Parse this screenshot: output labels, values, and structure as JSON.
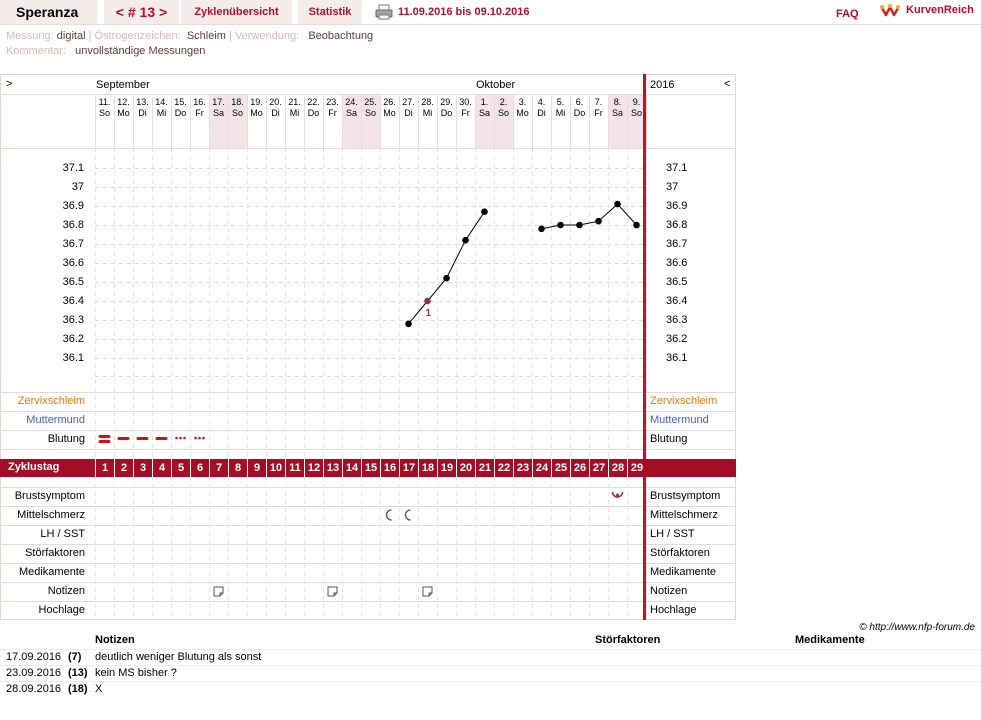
{
  "topbar": {
    "username": "Speranza",
    "cycle": "< # 13 >",
    "tab_overview": "Zyklenübersicht",
    "tab_stats": "Statistik",
    "date_range": "11.09.2016 bis 09.10.2016",
    "faq": "FAQ",
    "logo": "KurvenReich"
  },
  "meta": {
    "messung_label": "Messung:",
    "messung_value": "digital",
    "oestrogen_label": "Östrogenzeichen:",
    "oestrogen_value": "Schleim",
    "verwendung_label": "Verwendung:",
    "verwendung_value": "Beobachtung",
    "kommentar_label": "Kommentar:",
    "kommentar_value": "unvollständige Messungen"
  },
  "chart_header": {
    "left_arrow": ">",
    "right_arrow": "<",
    "month1": "September",
    "month2": "Oktober",
    "year": "2016"
  },
  "days": [
    {
      "d": "11.",
      "w": "So",
      "we": false
    },
    {
      "d": "12.",
      "w": "Mo",
      "we": false
    },
    {
      "d": "13.",
      "w": "Di",
      "we": false
    },
    {
      "d": "14.",
      "w": "Mi",
      "we": false
    },
    {
      "d": "15.",
      "w": "Do",
      "we": false
    },
    {
      "d": "16.",
      "w": "Fr",
      "we": false
    },
    {
      "d": "17.",
      "w": "Sa",
      "we": true
    },
    {
      "d": "18.",
      "w": "So",
      "we": true
    },
    {
      "d": "19.",
      "w": "Mo",
      "we": false
    },
    {
      "d": "20.",
      "w": "Di",
      "we": false
    },
    {
      "d": "21.",
      "w": "Mi",
      "we": false
    },
    {
      "d": "22.",
      "w": "Do",
      "we": false
    },
    {
      "d": "23.",
      "w": "Fr",
      "we": false
    },
    {
      "d": "24.",
      "w": "Sa",
      "we": true
    },
    {
      "d": "25.",
      "w": "So",
      "we": true
    },
    {
      "d": "26.",
      "w": "Mo",
      "we": false
    },
    {
      "d": "27.",
      "w": "Di",
      "we": false
    },
    {
      "d": "28.",
      "w": "Mi",
      "we": false
    },
    {
      "d": "29.",
      "w": "Do",
      "we": false
    },
    {
      "d": "30.",
      "w": "Fr",
      "we": false
    },
    {
      "d": "1.",
      "w": "Sa",
      "we": true
    },
    {
      "d": "2.",
      "w": "So",
      "we": true
    },
    {
      "d": "3.",
      "w": "Mo",
      "we": false
    },
    {
      "d": "4.",
      "w": "Di",
      "we": false
    },
    {
      "d": "5.",
      "w": "Mi",
      "we": false
    },
    {
      "d": "6.",
      "w": "Do",
      "we": false
    },
    {
      "d": "7.",
      "w": "Fr",
      "we": false
    },
    {
      "d": "8.",
      "w": "Sa",
      "we": true
    },
    {
      "d": "9.",
      "w": "So",
      "we": true
    }
  ],
  "chart_data": {
    "type": "line",
    "y_ticks": [
      "37.1",
      "37",
      "36.9",
      "36.8",
      "36.7",
      "36.6",
      "36.5",
      "36.4",
      "36.3",
      "36.2",
      "36.1"
    ],
    "ylim": [
      36.0,
      37.15
    ],
    "x": [
      17,
      18,
      19,
      20,
      21,
      24,
      25,
      26,
      27,
      28,
      29
    ],
    "values": [
      36.28,
      36.4,
      36.52,
      36.72,
      36.87,
      36.78,
      36.8,
      36.8,
      36.82,
      36.91,
      36.8
    ],
    "marked_day": 18,
    "point_label": "1",
    "line_color": "#000000",
    "marked_color": "#8b3a3a"
  },
  "rows_upper": [
    "Zervixschleim",
    "Muttermund",
    "Blutung"
  ],
  "rows_lower": [
    "Brustsymptom",
    "Mittelschmerz",
    "LH / SST",
    "Störfaktoren",
    "Medikamente",
    "Notizen",
    "Hochlage"
  ],
  "bleeding": [
    {
      "day": 1,
      "type": "strong"
    },
    {
      "day": 2,
      "type": "medium"
    },
    {
      "day": 3,
      "type": "medium"
    },
    {
      "day": 4,
      "type": "medium"
    },
    {
      "day": 5,
      "type": "spotting"
    },
    {
      "day": 6,
      "type": "spotting"
    }
  ],
  "cycle_label": "Zyklustag",
  "cycle_days": [
    "1",
    "2",
    "3",
    "4",
    "5",
    "6",
    "7",
    "8",
    "9",
    "10",
    "11",
    "12",
    "13",
    "14",
    "15",
    "16",
    "17",
    "18",
    "19",
    "20",
    "21",
    "22",
    "23",
    "24",
    "25",
    "26",
    "27",
    "28",
    "29"
  ],
  "symbols": {
    "brust_days": [
      28
    ],
    "mittelschmerz_days": [
      16,
      17
    ],
    "notiz_days": [
      7,
      13,
      18
    ]
  },
  "colors": {
    "accent": "#a50d26",
    "zervix": "#e07a10",
    "muttermund": "#4a58c8",
    "blutung": "#d11111",
    "weekend": "#f4e3e7"
  },
  "copyright": "© http://www.nfp-forum.de",
  "notes": {
    "h_notes": "Notizen",
    "h_stoer": "Störfaktoren",
    "h_medi": "Medikamente",
    "items": [
      {
        "date": "17.09.2016",
        "day": "(7)",
        "text": "deutlich weniger Blutung als sonst"
      },
      {
        "date": "23.09.2016",
        "day": "(13)",
        "text": "kein MS bisher ?"
      },
      {
        "date": "28.09.2016",
        "day": "(18)",
        "text": "X"
      }
    ]
  }
}
